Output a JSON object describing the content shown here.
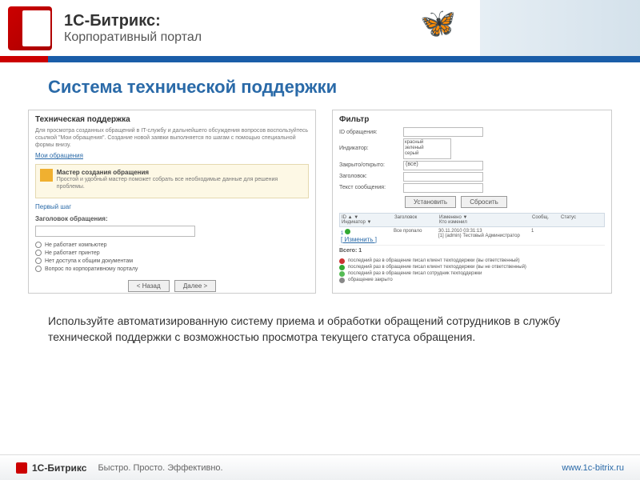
{
  "header": {
    "brand_line1": "1С-Битрикс:",
    "brand_line2": "Корпоративный портал"
  },
  "page_title": "Система технической поддержки",
  "left_panel": {
    "title": "Техническая поддержка",
    "description": "Для просмотра созданных обращений в IT-службу и дальнейшего обсуждения вопросов воспользуйтесь ссылкой \"Мои обращения\". Создание новой заявки выполняется по шагам с помощью специальной формы внизу.",
    "my_requests_link": "Мои обращения",
    "wizard_title": "Мастер создания обращения",
    "wizard_subtitle": "Простой и удобный мастер поможет собрать все необходимые данные для решения проблемы.",
    "first_step": "Первый шаг",
    "field_heading": "Заголовок обращения:",
    "radio_options": [
      "Не работает компьютер",
      "Не работает принтер",
      "Нет доступа к общим документам",
      "Вопрос по корпоративному порталу"
    ],
    "back_btn": "< Назад",
    "next_btn": "Далее >"
  },
  "right_panel": {
    "filter_title": "Фильтр",
    "filters": {
      "id_label": "ID обращения:",
      "indicator_label": "Индикатор:",
      "indicator_options": [
        "красный",
        "зеленый",
        "серый"
      ],
      "closed_label": "Закрыто/открыто:",
      "closed_value": "(все)",
      "title_label": "Заголовок:",
      "text_label": "Текст сообщения:"
    },
    "apply_btn": "Установить",
    "reset_btn": "Сбросить",
    "table": {
      "col_id": "ID ▲ ▼",
      "col_indicator": "Индикатор ▼",
      "col_title": "Заголовок",
      "col_changed": "Изменено ▼",
      "col_changed_by": "Кто изменил",
      "col_msgs": "Сообщ.",
      "col_status": "Статус",
      "row_id": "1",
      "row_action": "[ Изменить ]",
      "row_title": "Все пропало",
      "row_date": "30.11.2010 03:31:13",
      "row_user": "[1] (admin) Тестовый Администратор",
      "row_msgs": "1",
      "total_label": "Всего: 1"
    },
    "legend": [
      "последний раз в обращение писал клиент техподдержки (вы ответственный)",
      "последний раз в обращение писал клиент техподдержки (вы не ответственный)",
      "последний раз в обращение писал сотрудник техподдержки",
      "обращение закрыто"
    ]
  },
  "body_text": "Используйте автоматизированную систему приема и обработки обращений сотрудников в службу технической поддержки с  возможностью просмотра текущего статуса обращения.",
  "footer": {
    "brand": "1С-Битрикс",
    "slogan": "Быстро. Просто. Эффективно.",
    "url": "www.1c-bitrix.ru"
  }
}
